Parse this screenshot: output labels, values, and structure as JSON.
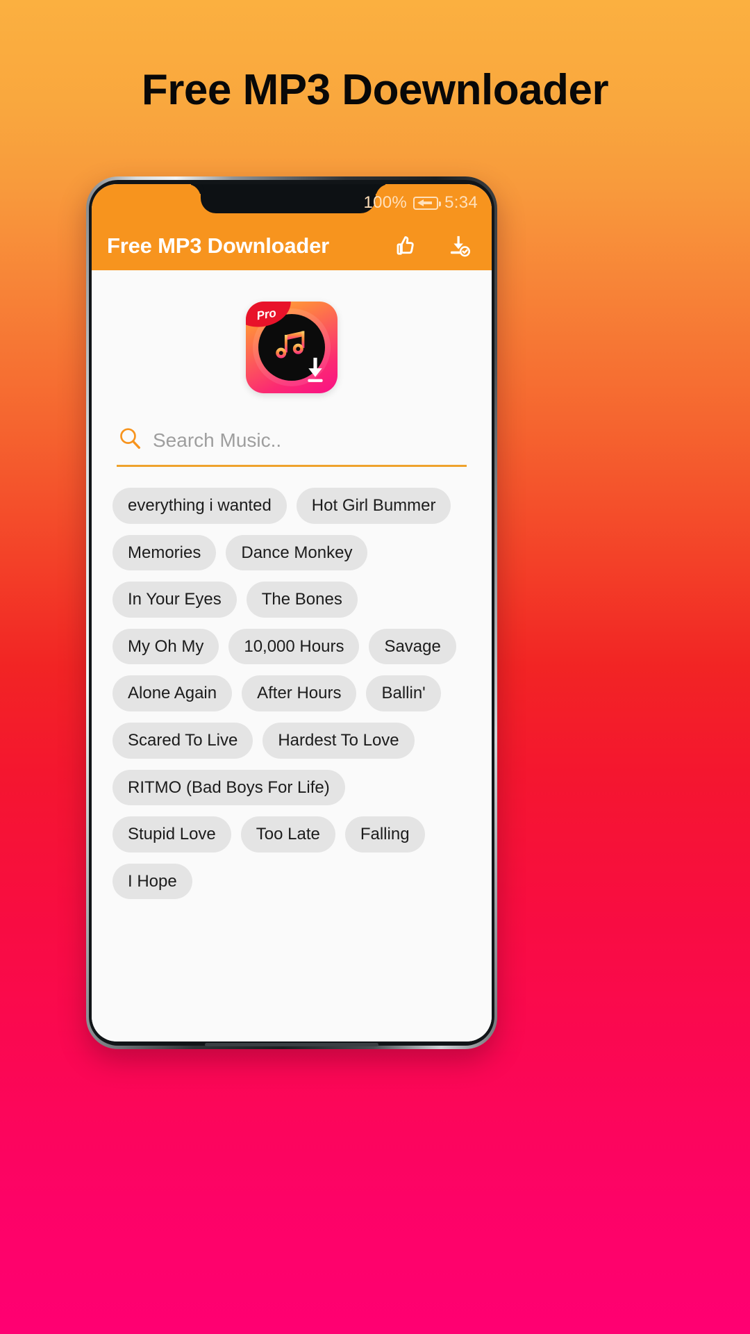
{
  "promo": {
    "headline": "Free MP3 Doewnloader"
  },
  "colors": {
    "bg_top": "#fbb040",
    "bg_mid": "#f22424",
    "bg_bottom": "#ff0072",
    "accent_orange": "#f7941e",
    "search_underline": "#efa22c",
    "chip_bg": "#e4e4e4",
    "pro_badge_red": "#e8132a"
  },
  "phone": {
    "status_bar": {
      "battery_percent": "100%",
      "battery_icon": "battery-charging-icon",
      "time": "5:34"
    },
    "app_bar": {
      "title": "Free MP3 Downloader",
      "actions": [
        {
          "name": "thumbs-up-icon",
          "label": "Like"
        },
        {
          "name": "download-check-icon",
          "label": "Downloads"
        }
      ]
    },
    "logo": {
      "badge_text": "Pro",
      "icon_names": [
        "music-note-icon",
        "download-arrow-icon"
      ]
    },
    "search": {
      "icon": "search-icon",
      "placeholder": "Search Music..",
      "value": ""
    },
    "suggestions": [
      "everything i wanted",
      "Hot Girl Bummer",
      "Memories",
      "Dance Monkey",
      "In Your Eyes",
      "The Bones",
      "My Oh My",
      "10,000 Hours",
      "Savage",
      "Alone Again",
      "After Hours",
      "Ballin'",
      "Scared To Live",
      "Hardest To Love",
      "RITMO (Bad Boys For Life)",
      "Stupid Love",
      "Too Late",
      "Falling",
      "I Hope"
    ]
  }
}
